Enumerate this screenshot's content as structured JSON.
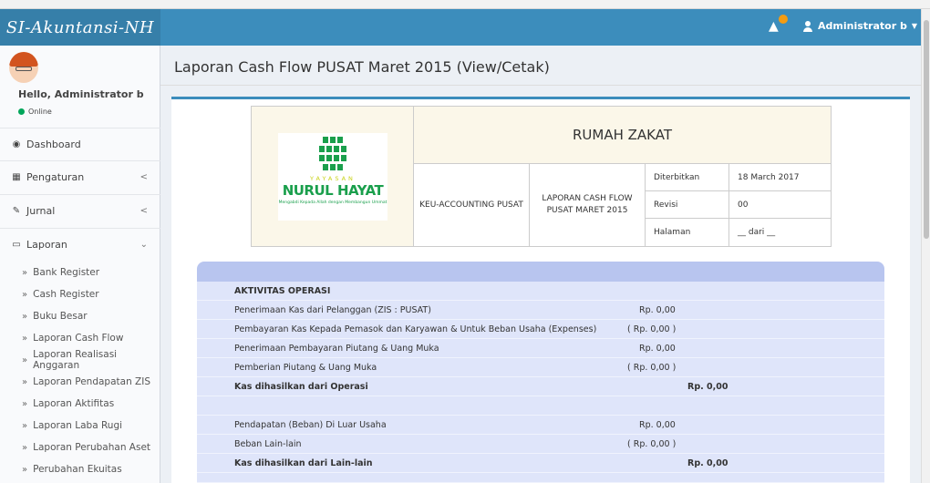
{
  "app": {
    "brand": "SI-Akuntansi-NH"
  },
  "navbar": {
    "user_label": "Administrator b",
    "alert_icon": "warning-icon",
    "user_icon": "user-icon",
    "badge_color": "#f39c12"
  },
  "sidebar": {
    "greeting": "Hello, Administrator b",
    "status": "Online",
    "menu": [
      {
        "label": "Dashboard",
        "icon": "dashboard-icon"
      },
      {
        "label": "Pengaturan",
        "icon": "grid-icon"
      },
      {
        "label": "Jurnal",
        "icon": "edit-icon"
      },
      {
        "label": "Laporan",
        "icon": "laptop-icon"
      }
    ],
    "submenu": [
      "Bank Register",
      "Cash Register",
      "Buku Besar",
      "Laporan Cash Flow",
      "Laporan Realisasi Anggaran",
      "Laporan Pendapatan ZIS",
      "Laporan Aktifitas",
      "Laporan Laba Rugi",
      "Laporan Perubahan Aset",
      "Perubahan Ekuitas"
    ]
  },
  "page": {
    "title": "Laporan Cash Flow PUSAT Maret 2015 (View/Cetak)"
  },
  "report_header": {
    "logo": {
      "top": "YAYASAN",
      "name": "NURUL HAYAT",
      "tagline": "Mengabdi Kepada Allah dengan Membangun Ummat"
    },
    "company": "RUMAH ZAKAT",
    "department": "KEU-ACCOUNTING PUSAT",
    "report_title": "LAPORAN CASH FLOW PUSAT MARET 2015",
    "meta": [
      {
        "label": "Diterbitkan",
        "value": "18 March 2017"
      },
      {
        "label": "Revisi",
        "value": "00"
      },
      {
        "label": "Halaman",
        "value": "__ dari __"
      }
    ]
  },
  "report_rows": [
    {
      "label": "AKTIVITAS OPERASI",
      "amount": "",
      "kind": "section"
    },
    {
      "label": "Penerimaan Kas dari Pelanggan (ZIS : PUSAT)",
      "amount": "Rp. 0,00",
      "kind": "item"
    },
    {
      "label": "Pembayaran Kas Kepada Pemasok dan Karyawan & Untuk Beban Usaha (Expenses)",
      "amount": "( Rp. 0,00 )",
      "kind": "item"
    },
    {
      "label": "Penerimaan Pembayaran Piutang & Uang Muka",
      "amount": "Rp. 0,00",
      "kind": "item"
    },
    {
      "label": "Pemberian Piutang & Uang Muka",
      "amount": "( Rp. 0,00 )",
      "kind": "item"
    },
    {
      "label": "Kas dihasilkan dari Operasi",
      "amount": "Rp. 0,00",
      "kind": "total"
    },
    {
      "label": "",
      "amount": "",
      "kind": "blank"
    },
    {
      "label": "Pendapatan (Beban) Di Luar Usaha",
      "amount": "Rp. 0,00",
      "kind": "item"
    },
    {
      "label": "Beban Lain-lain",
      "amount": "( Rp. 0,00 )",
      "kind": "item"
    },
    {
      "label": "Kas dihasilkan dari Lain-lain",
      "amount": "Rp. 0,00",
      "kind": "total"
    }
  ]
}
